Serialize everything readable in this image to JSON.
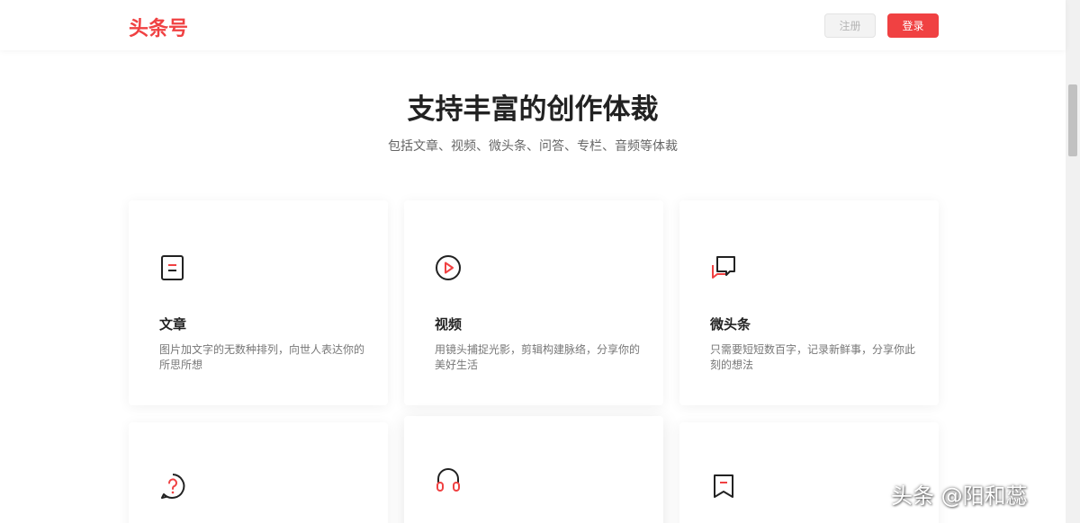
{
  "header": {
    "logo": "头条号",
    "register_label": "注册",
    "login_label": "登录"
  },
  "hero": {
    "title": "支持丰富的创作体裁",
    "subtitle": "包括文章、视频、微头条、问答、专栏、音频等体裁"
  },
  "cards": [
    {
      "title": "文章",
      "desc": "图片加文字的无数种排列，向世人表达你的所思所想",
      "icon": "article-icon"
    },
    {
      "title": "视频",
      "desc": "用镜头捕捉光影，剪辑构建脉络，分享你的美好生活",
      "icon": "video-play-icon"
    },
    {
      "title": "微头条",
      "desc": "只需要短短数百字，记录新鲜事，分享你此刻的想法",
      "icon": "chat-bubble-icon"
    },
    {
      "icon": "question-icon"
    },
    {
      "icon": "headphones-icon"
    },
    {
      "icon": "bookmark-icon"
    }
  ],
  "watermark": "头条 @阳和蕊",
  "colors": {
    "accent": "#f04142",
    "text": "#222222",
    "muted": "#777777"
  }
}
